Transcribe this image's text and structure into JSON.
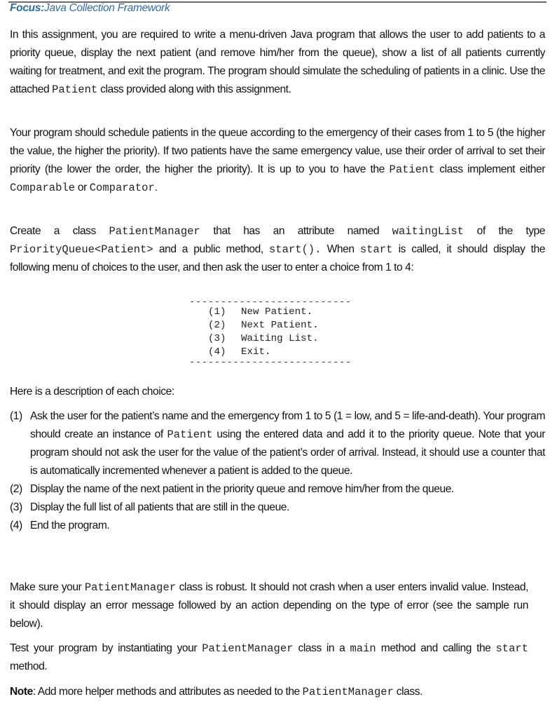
{
  "header": {
    "focus_label": "Focus:",
    "focus_topic": "Java Collection Framework",
    "accent_color": "#2f6db3"
  },
  "intro": {
    "text_before": "In this assignment, you are required to write a menu-driven Java program that allows the user to add patients to a priority queue, display the next patient (and remove him/her from the queue), show a list of all patients currently waiting for treatment, and exit the program. The program should simulate the scheduling of patients in a clinic. Use the attached ",
    "code_patient": "Patient",
    "text_after": " class provided along with this assignment."
  },
  "priority": {
    "text_1": "Your program should schedule patients in the queue according to the emergency of their cases from 1 to 5 (the higher the value, the higher the priority). If two patients have the same emergency value, use their order of arrival to set their priority (the lower the order, the higher the priority). It is up to you to have the ",
    "code_patient": "Patient",
    "text_2": " class implement either ",
    "code_comparable": "Comparable",
    "text_3": " or ",
    "code_comparator": "Comparator",
    "text_4": "."
  },
  "manager": {
    "text_1": "Create a class ",
    "code_class": "PatientManager",
    "text_2": " that has an attribute named ",
    "code_attr": "waitingList",
    "text_3": " of the type ",
    "code_type": "PriorityQueue<Patient>",
    "text_4": " and a public method, ",
    "code_method": "start().",
    "text_5": " When ",
    "code_start": "start",
    "text_6": " is called, it should display the following menu of choices to the user, and then ask the user to enter a choice from 1 to 4:"
  },
  "menu": {
    "separator": "--------------------------",
    "items": [
      {
        "num": "(1)",
        "label": "New Patient."
      },
      {
        "num": "(2)",
        "label": "Next Patient."
      },
      {
        "num": "(3)",
        "label": "Waiting List."
      },
      {
        "num": "(4)",
        "label": "Exit."
      }
    ]
  },
  "choices": {
    "intro": "Here is a description of each choice:",
    "items": [
      {
        "marker": "(1)",
        "text_1": "Ask the user for the patient’s name and the emergency from 1 to 5 (1 = low, and 5 = life-and-death). Your program should create an instance of ",
        "code": "Patient",
        "text_2": " using the entered data and add it to the priority queue. Note that your program should not ask the user for the value of the patient’s order of arrival. Instead, it should use a counter that is automatically incremented whenever a patient is added to the queue."
      },
      {
        "marker": "(2)",
        "text": "Display the name of the next patient in the priority queue and remove him/her from the queue."
      },
      {
        "marker": "(3)",
        "text": "Display the full list of all patients that are still in the queue."
      },
      {
        "marker": "(4)",
        "text": "End the program."
      }
    ]
  },
  "robust": {
    "text_1": "Make sure your ",
    "code_class": "PatientManager",
    "text_2": " class is robust. It should not crash when a user enters invalid value. Instead, it should display an error message followed by an action depending on the type of error (see the sample run below)."
  },
  "test": {
    "text_1": "Test your program by instantiating your ",
    "code_class": "PatientManager",
    "text_2": " class in a ",
    "code_main": "main",
    "text_3": " method and calling the ",
    "code_start": "start",
    "text_4": " method."
  },
  "note": {
    "label": "Note",
    "text_1": ": Add more helper methods and attributes as needed to the ",
    "code_class": "PatientManager",
    "text_2": " class."
  }
}
